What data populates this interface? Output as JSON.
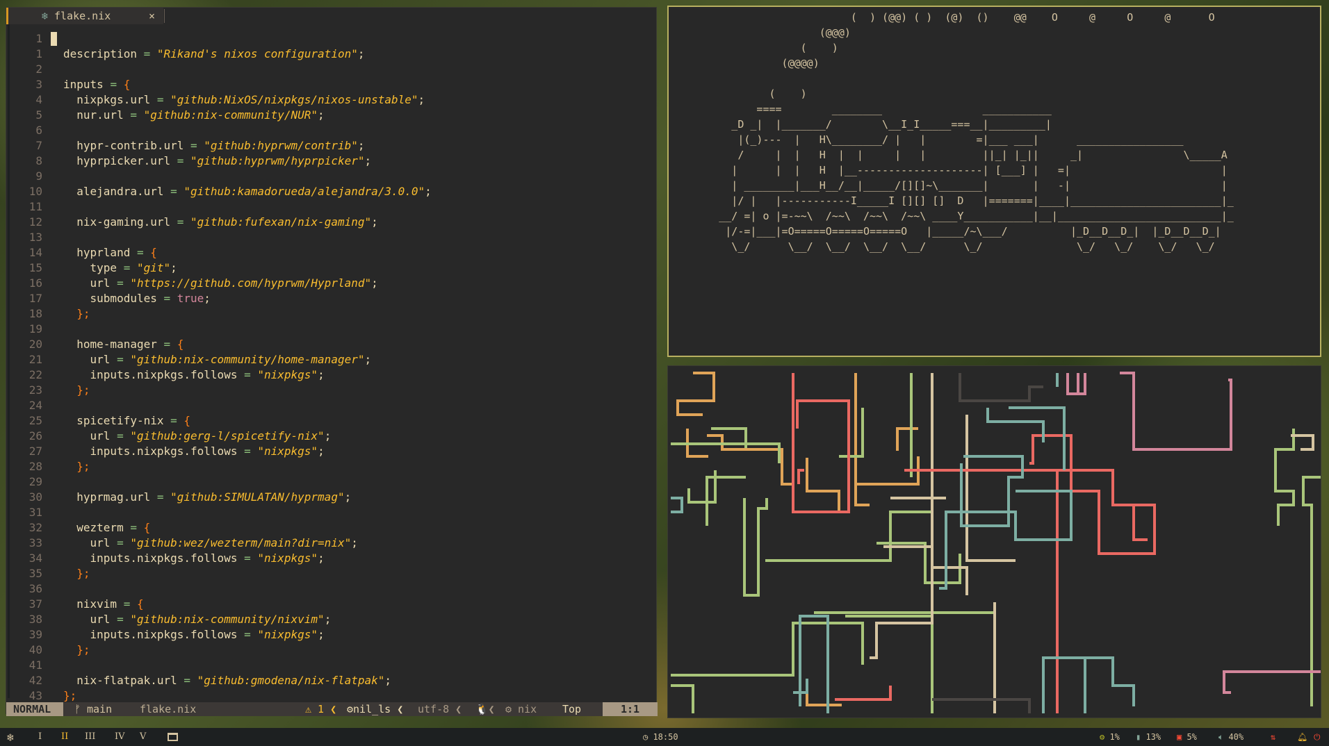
{
  "editor": {
    "tab": {
      "icon": "nix-snowflake-icon",
      "name": "flake.nix",
      "close": "×"
    },
    "lines": [
      {
        "n": "1",
        "t": []
      },
      {
        "n": "1",
        "t": [
          [
            "id",
            "description "
          ],
          [
            "op",
            "= "
          ],
          [
            "st",
            "\"Rikand's nixos configuration\""
          ],
          [
            "pu",
            ";"
          ]
        ]
      },
      {
        "n": "2",
        "t": []
      },
      {
        "n": "3",
        "t": [
          [
            "id",
            "inputs "
          ],
          [
            "op",
            "= "
          ],
          [
            "br",
            "{"
          ]
        ]
      },
      {
        "n": "4",
        "t": [
          [
            "id",
            "  nixpkgs.url "
          ],
          [
            "op",
            "= "
          ],
          [
            "st",
            "\"github:NixOS/nixpkgs/nixos-unstable\""
          ],
          [
            "pu",
            ";"
          ]
        ]
      },
      {
        "n": "5",
        "t": [
          [
            "id",
            "  nur.url "
          ],
          [
            "op",
            "= "
          ],
          [
            "st",
            "\"github:nix-community/NUR\""
          ],
          [
            "pu",
            ";"
          ]
        ]
      },
      {
        "n": "6",
        "t": []
      },
      {
        "n": "7",
        "t": [
          [
            "id",
            "  hypr-contrib.url "
          ],
          [
            "op",
            "= "
          ],
          [
            "st",
            "\"github:hyprwm/contrib\""
          ],
          [
            "pu",
            ";"
          ]
        ]
      },
      {
        "n": "8",
        "t": [
          [
            "id",
            "  hyprpicker.url "
          ],
          [
            "op",
            "= "
          ],
          [
            "st",
            "\"github:hyprwm/hyprpicker\""
          ],
          [
            "pu",
            ";"
          ]
        ]
      },
      {
        "n": "9",
        "t": []
      },
      {
        "n": "10",
        "t": [
          [
            "id",
            "  alejandra.url "
          ],
          [
            "op",
            "= "
          ],
          [
            "st",
            "\"github:kamadorueda/alejandra/3.0.0\""
          ],
          [
            "pu",
            ";"
          ]
        ]
      },
      {
        "n": "11",
        "t": []
      },
      {
        "n": "12",
        "t": [
          [
            "id",
            "  nix-gaming.url "
          ],
          [
            "op",
            "= "
          ],
          [
            "st",
            "\"github:fufexan/nix-gaming\""
          ],
          [
            "pu",
            ";"
          ]
        ]
      },
      {
        "n": "13",
        "t": []
      },
      {
        "n": "14",
        "t": [
          [
            "id",
            "  hyprland "
          ],
          [
            "op",
            "= "
          ],
          [
            "br",
            "{"
          ]
        ]
      },
      {
        "n": "15",
        "t": [
          [
            "id",
            "    type "
          ],
          [
            "op",
            "= "
          ],
          [
            "st",
            "\"git\""
          ],
          [
            "pu",
            ";"
          ]
        ]
      },
      {
        "n": "16",
        "t": [
          [
            "id",
            "    url "
          ],
          [
            "op",
            "= "
          ],
          [
            "st",
            "\"https://github.com/hyprwm/Hyprland\""
          ],
          [
            "pu",
            ";"
          ]
        ]
      },
      {
        "n": "17",
        "t": [
          [
            "id",
            "    submodules "
          ],
          [
            "op",
            "= "
          ],
          [
            "kw",
            "true"
          ],
          [
            "pu",
            ";"
          ]
        ]
      },
      {
        "n": "18",
        "t": [
          [
            "br",
            "  };"
          ]
        ]
      },
      {
        "n": "19",
        "t": []
      },
      {
        "n": "20",
        "t": [
          [
            "id",
            "  home-manager "
          ],
          [
            "op",
            "= "
          ],
          [
            "br",
            "{"
          ]
        ]
      },
      {
        "n": "21",
        "t": [
          [
            "id",
            "    url "
          ],
          [
            "op",
            "= "
          ],
          [
            "st",
            "\"github:nix-community/home-manager\""
          ],
          [
            "pu",
            ";"
          ]
        ]
      },
      {
        "n": "22",
        "t": [
          [
            "id",
            "    inputs.nixpkgs.follows "
          ],
          [
            "op",
            "= "
          ],
          [
            "st",
            "\"nixpkgs\""
          ],
          [
            "pu",
            ";"
          ]
        ]
      },
      {
        "n": "23",
        "t": [
          [
            "br",
            "  };"
          ]
        ]
      },
      {
        "n": "24",
        "t": []
      },
      {
        "n": "25",
        "t": [
          [
            "id",
            "  spicetify-nix "
          ],
          [
            "op",
            "= "
          ],
          [
            "br",
            "{"
          ]
        ]
      },
      {
        "n": "26",
        "t": [
          [
            "id",
            "    url "
          ],
          [
            "op",
            "= "
          ],
          [
            "st",
            "\"github:gerg-l/spicetify-nix\""
          ],
          [
            "pu",
            ";"
          ]
        ]
      },
      {
        "n": "27",
        "t": [
          [
            "id",
            "    inputs.nixpkgs.follows "
          ],
          [
            "op",
            "= "
          ],
          [
            "st",
            "\"nixpkgs\""
          ],
          [
            "pu",
            ";"
          ]
        ]
      },
      {
        "n": "28",
        "t": [
          [
            "br",
            "  };"
          ]
        ]
      },
      {
        "n": "29",
        "t": []
      },
      {
        "n": "30",
        "t": [
          [
            "id",
            "  hyprmag.url "
          ],
          [
            "op",
            "= "
          ],
          [
            "st",
            "\"github:SIMULATAN/hyprmag\""
          ],
          [
            "pu",
            ";"
          ]
        ]
      },
      {
        "n": "31",
        "t": []
      },
      {
        "n": "32",
        "t": [
          [
            "id",
            "  wezterm "
          ],
          [
            "op",
            "= "
          ],
          [
            "br",
            "{"
          ]
        ]
      },
      {
        "n": "33",
        "t": [
          [
            "id",
            "    url "
          ],
          [
            "op",
            "= "
          ],
          [
            "st",
            "\"github:wez/wezterm/main?dir=nix\""
          ],
          [
            "pu",
            ";"
          ]
        ]
      },
      {
        "n": "34",
        "t": [
          [
            "id",
            "    inputs.nixpkgs.follows "
          ],
          [
            "op",
            "= "
          ],
          [
            "st",
            "\"nixpkgs\""
          ],
          [
            "pu",
            ";"
          ]
        ]
      },
      {
        "n": "35",
        "t": [
          [
            "br",
            "  };"
          ]
        ]
      },
      {
        "n": "36",
        "t": []
      },
      {
        "n": "37",
        "t": [
          [
            "id",
            "  nixvim "
          ],
          [
            "op",
            "= "
          ],
          [
            "br",
            "{"
          ]
        ]
      },
      {
        "n": "38",
        "t": [
          [
            "id",
            "    url "
          ],
          [
            "op",
            "= "
          ],
          [
            "st",
            "\"github:nix-community/nixvim\""
          ],
          [
            "pu",
            ";"
          ]
        ]
      },
      {
        "n": "39",
        "t": [
          [
            "id",
            "    inputs.nixpkgs.follows "
          ],
          [
            "op",
            "= "
          ],
          [
            "st",
            "\"nixpkgs\""
          ],
          [
            "pu",
            ";"
          ]
        ]
      },
      {
        "n": "40",
        "t": [
          [
            "br",
            "  };"
          ]
        ]
      },
      {
        "n": "41",
        "t": []
      },
      {
        "n": "42",
        "t": [
          [
            "id",
            "  nix-flatpak.url "
          ],
          [
            "op",
            "= "
          ],
          [
            "st",
            "\"github:gmodena/nix-flatpak\""
          ],
          [
            "pu",
            ";"
          ]
        ]
      },
      {
        "n": "43",
        "t": [
          [
            "br",
            "};"
          ]
        ]
      }
    ],
    "status": {
      "mode": "NORMAL",
      "branch": "ᚠ main",
      "file": "flake.nix",
      "diagnostics": "⚠ 1 ❮",
      "lsp": "⚙nil_ls ❮",
      "encoding": "utf-8 ❮",
      "os": "🐧❮",
      "filetype": "⚙ nix",
      "position": "Top",
      "cursor": "1:1"
    }
  },
  "terminal_top": {
    "ascii": "                             (  ) (@@) ( )  (@)  ()    @@    O     @     O     @      O\n                        (@@@)\n                     (    )\n                  (@@@@)\n\n                (    )\n              ====        ________                ___________\n          _D _|  |_______/        \\__I_I_____===__|_________|\n           |(_)---  |   H\\________/ |   |        =|___ ___|      _________________\n           /     |  |   H  |  |     |   |         ||_| |_||     _|                \\_____A\n          |      |  |   H  |__--------------------| [___] |   =|                        |\n          | ________|___H__/__|_____/[][]~\\_______|       |   -|                        |\n          |/ |   |-----------I_____I [][] []  D   |=======|____|________________________|_\n        __/ =| o |=-~~\\  /~~\\  /~~\\  /~~\\ ____Y___________|__|__________________________|_\n         |/-=|___|=O=====O=====O=====O   |_____/~\\___/          |_D__D__D_|  |_D__D__D_|\n          \\_/      \\__/  \\__/  \\__/  \\__/      \\_/               \\_/   \\_/    \\_/   \\_/"
  },
  "bar": {
    "logo": "nix-snowflake-icon",
    "workspaces": [
      "I",
      "II",
      "III",
      "IV",
      "V"
    ],
    "active_workspace": "II",
    "window_icon": "window-icon",
    "clock": "18:50",
    "cpu": "1%",
    "memory": "13%",
    "disk": "5%",
    "volume": "40%",
    "icons": {
      "cpu": "cpu-icon",
      "memory": "memory-icon",
      "disk": "disk-icon",
      "volume": "volume-icon",
      "network": "network-icon",
      "notification": "bell-icon",
      "power": "power-icon"
    }
  }
}
